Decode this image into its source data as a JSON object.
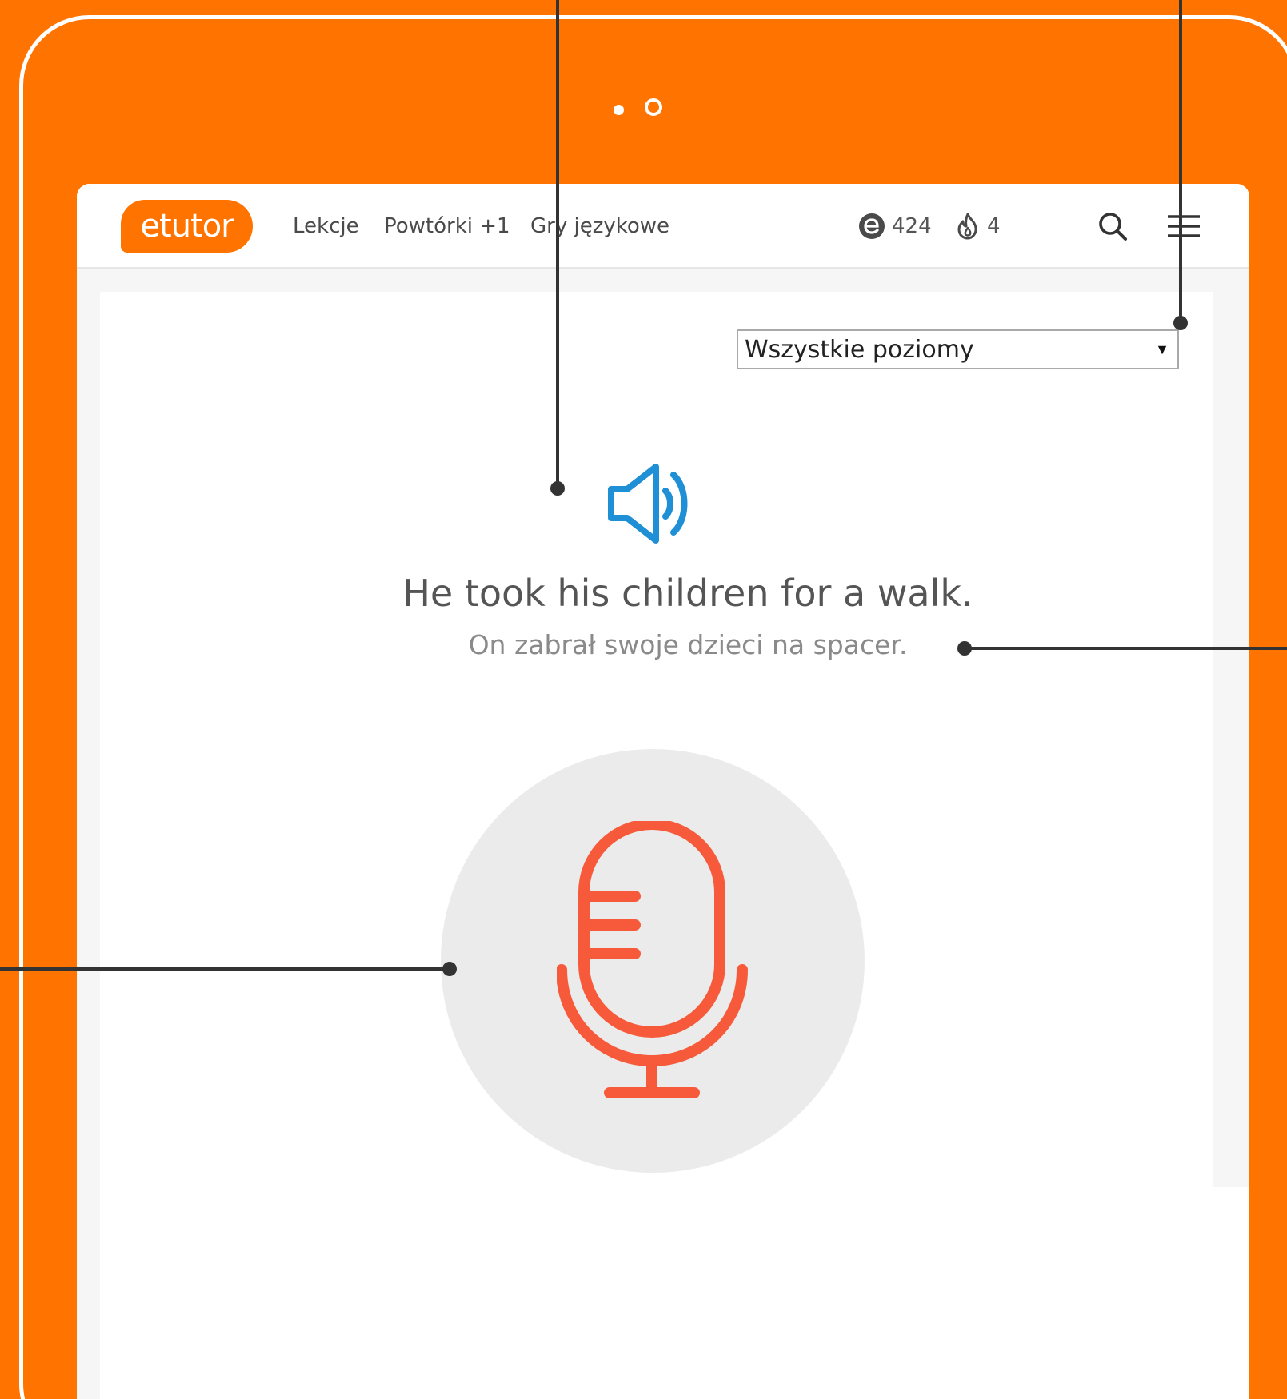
{
  "app": {
    "logo_text": "etutor"
  },
  "nav": {
    "links": [
      {
        "label": "Lekcje"
      },
      {
        "label": "Powtórki +1"
      },
      {
        "label": "Gry językowe"
      }
    ],
    "points_value": "424",
    "streak_value": "4",
    "icons": {
      "points": "etutor-points-icon",
      "streak": "flame-icon",
      "search": "search-icon",
      "menu": "hamburger-menu-icon"
    }
  },
  "level_select": {
    "selected": "Wszystkie poziomy",
    "arrow": "▼"
  },
  "exercise": {
    "sentence_en": "He took his children for a walk.",
    "sentence_pl": "On zabrał swoje dzieci na spacer.",
    "speaker_icon": "speaker-icon",
    "mic_icon": "microphone-icon"
  },
  "colors": {
    "background": "#ff7300",
    "brand": "#ff7300",
    "speaker": "#1f8fd6",
    "microphone": "#f65a3a",
    "mic_circle": "#ebebeb",
    "callout_line": "#333333"
  }
}
